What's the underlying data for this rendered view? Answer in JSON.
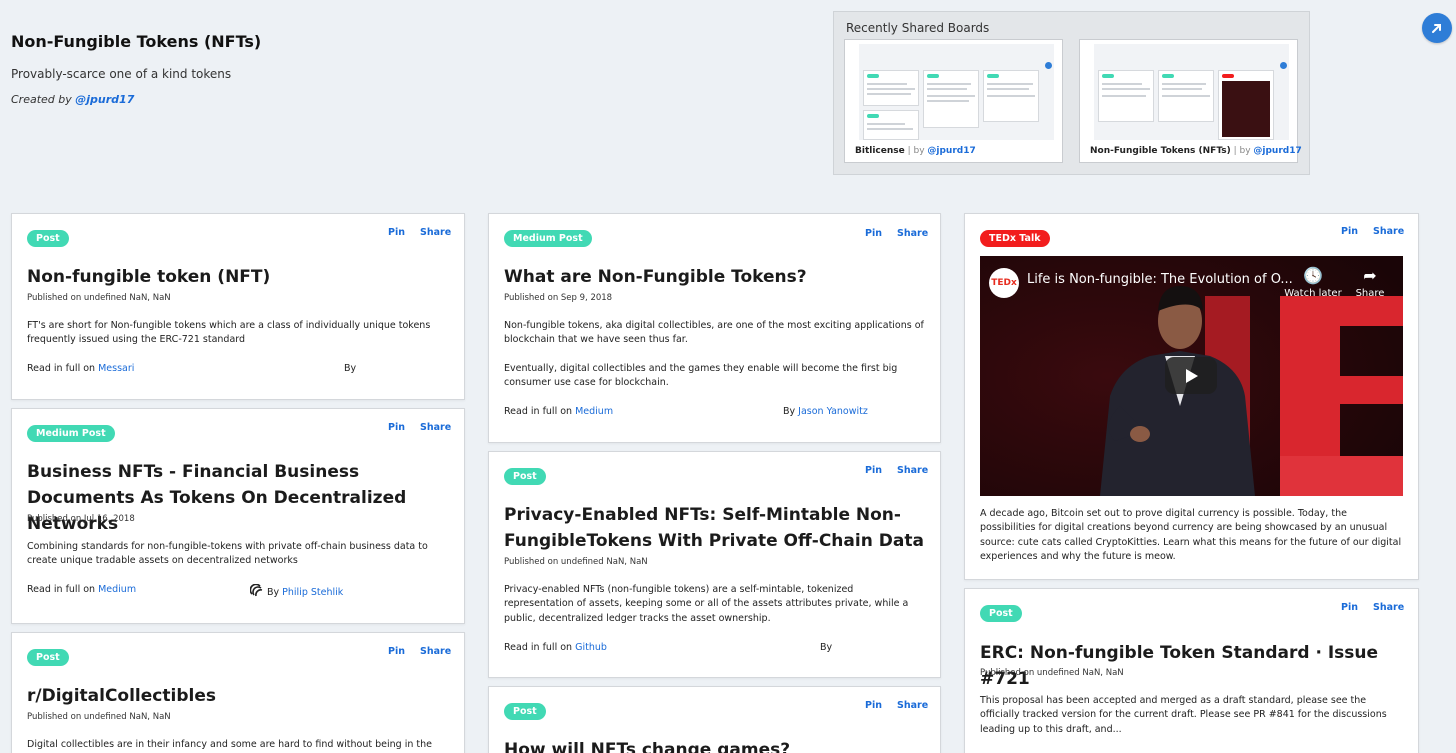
{
  "board": {
    "title": "Non-Fungible Tokens (NFTs)",
    "description": "Provably-scarce one of a kind tokens",
    "created_prefix": "Created by ",
    "created_by": "@jpurd17"
  },
  "recent": {
    "title": "Recently Shared Boards",
    "boards": [
      {
        "name": "Bitlicense",
        "separator": " | by ",
        "author": "@jpurd17"
      },
      {
        "name": "Non-Fungible Tokens (NFTs)",
        "separator": " | by ",
        "author": "@jpurd17"
      }
    ]
  },
  "actions": {
    "pin": "Pin",
    "share": "Share"
  },
  "cards": [
    {
      "tag": "Post",
      "title": "Non-fungible token (NFT)",
      "date": "Published on undefined NaN, NaN",
      "body": "FT's are short for Non-fungible tokens which are a class of individually unique tokens frequently issued using the ERC-721 standard",
      "read_prefix": "Read in full on ",
      "source": "Messari",
      "by": "By",
      "author": ""
    },
    {
      "tag": "Medium Post",
      "title": "Business NFTs - Financial Business Documents As Tokens On Decentralized Networks",
      "date": "Published on Jul 16, 2018",
      "body": "Combining standards for non-fungible-tokens with private off-chain business data to create unique tradable assets on decentralized networks",
      "read_prefix": "Read in full on ",
      "source": "Medium",
      "by": "By ",
      "author": "Philip Stehlik"
    },
    {
      "tag": "Post",
      "title": "r/DigitalCollectibles",
      "date": "Published on undefined NaN, NaN",
      "body": "Digital collectibles are in their infancy and some are hard to find without being in the"
    },
    {
      "tag": "Medium Post",
      "title": "What are Non-Fungible Tokens?",
      "date": "Published on Sep 9, 2018",
      "body": "Non-fungible tokens, aka digital collectibles, are one of the most exciting applications of blockchain that we have seen thus far.",
      "body2": "Eventually, digital collectibles and the games they enable will become the first big consumer use case for blockchain.",
      "read_prefix": "Read in full on ",
      "source": "Medium",
      "by": "By ",
      "author": "Jason Yanowitz"
    },
    {
      "tag": "Post",
      "title": "Privacy-Enabled NFTs: Self-Mintable Non-FungibleTokens With Private Off-Chain Data",
      "date": "Published on undefined NaN, NaN",
      "body": "Privacy-enabled NFTs (non-fungible tokens) are a self-mintable, tokenized representation of assets, keeping some or all of the assets attributes private, while a public, decentralized ledger tracks the asset ownership.",
      "read_prefix": "Read in full on ",
      "source": "Github",
      "by": "By",
      "author": ""
    },
    {
      "tag": "Post",
      "title": "How will NFTs change games?"
    },
    {
      "tag": "TEDx Talk",
      "video": {
        "title": "Life is Non-fungible: The Evolution of O...",
        "logo": "TEDx",
        "watch_later": "Watch later",
        "share": "Share"
      },
      "body": "A decade ago, Bitcoin set out to prove digital currency is possible. Today, the possibilities for digital creations beyond currency are being showcased by an unusual source: cute cats called CryptoKitties. Learn what this means for the future of our digital experiences and why the future is meow."
    },
    {
      "tag": "Post",
      "title": "ERC: Non-fungible Token Standard · Issue #721",
      "date": "Published on undefined NaN, NaN",
      "body": "This proposal has been accepted and merged as a draft standard, please see the officially tracked version for the current draft. Please see PR #841 for the discussions leading up to this draft, and..."
    }
  ],
  "colors": {
    "accent": "#1a6bd8",
    "tag_green": "#41d9b4",
    "tag_red": "#f21d1d",
    "background": "#edf1f5"
  }
}
